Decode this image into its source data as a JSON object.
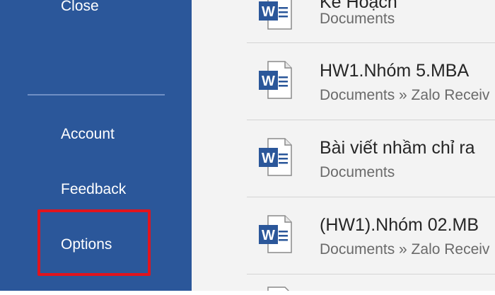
{
  "sidebar": {
    "close_label": "Close",
    "account_label": "Account",
    "feedback_label": "Feedback",
    "options_label": "Options",
    "background_color": "#2b579a",
    "highlight_color": "#e0141e"
  },
  "recent_documents": [
    {
      "name": "Kế Hoạch",
      "location": "Documents",
      "icon": "word-doc-icon"
    },
    {
      "name": "HW1.Nhóm 5.MBA",
      "location": "Documents » Zalo Receiv",
      "icon": "word-doc-icon"
    },
    {
      "name": "Bài viết nhầm chỉ ra",
      "location": "Documents",
      "icon": "word-doc-icon"
    },
    {
      "name": "(HW1).Nhóm 02.MB",
      "location": "Documents » Zalo Receiv",
      "icon": "word-doc-icon"
    }
  ],
  "colors": {
    "word_blue": "#2b579a",
    "list_background": "#f3f3f3"
  }
}
